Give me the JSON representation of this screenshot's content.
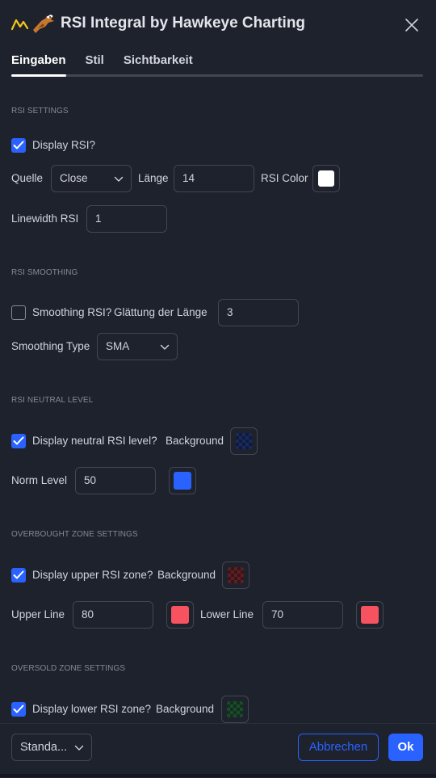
{
  "dialog": {
    "title": "RSI Integral by Hawkeye Charting",
    "tabs": [
      "Eingaben",
      "Stil",
      "Sichtbarkeit"
    ],
    "active_tab": "Eingaben"
  },
  "sections": {
    "rsi_settings": {
      "title": "RSI SETTINGS",
      "display_rsi_label": "Display RSI?",
      "display_rsi_checked": true,
      "quelle_label": "Quelle",
      "quelle_value": "Close",
      "laenge_label": "Länge",
      "laenge_value": "14",
      "rsi_color_label": "RSI Color",
      "rsi_color": "#ffffff",
      "linewidth_label": "Linewidth RSI",
      "linewidth_value": "1"
    },
    "rsi_smoothing": {
      "title": "RSI SMOOTHING",
      "smoothing_rsi_label": "Smoothing RSI?",
      "smoothing_rsi_checked": false,
      "glaettung_label": "Glättung der Länge",
      "glaettung_value": "3",
      "smoothing_type_label": "Smoothing Type",
      "smoothing_type_value": "SMA"
    },
    "rsi_neutral": {
      "title": "RSI NEUTRAL LEVEL",
      "display_neutral_label": "Display neutral RSI level?",
      "display_neutral_checked": true,
      "background_label": "Background",
      "norm_level_label": "Norm Level",
      "norm_level_value": "50",
      "norm_color": "#2962ff"
    },
    "overbought": {
      "title": "OVERBOUGHT ZONE SETTINGS",
      "display_upper_label": "Display upper RSI zone?",
      "display_upper_checked": true,
      "background_label": "Background",
      "upper_line_label": "Upper Line",
      "upper_line_value": "80",
      "upper_line_color": "#f7525f",
      "lower_line_label": "Lower Line",
      "lower_line_value": "70",
      "lower_line_color": "#f7525f"
    },
    "oversold": {
      "title": "OVERSOLD ZONE SETTINGS",
      "display_lower_label": "Display lower RSI zone?",
      "display_lower_checked": true,
      "background_label": "Background"
    }
  },
  "footer": {
    "defaults_label": "Standa...",
    "cancel_label": "Abbrechen",
    "ok_label": "Ok"
  },
  "colors": {
    "accent": "#2962ff",
    "background": "#1e222d",
    "border": "#434651"
  }
}
